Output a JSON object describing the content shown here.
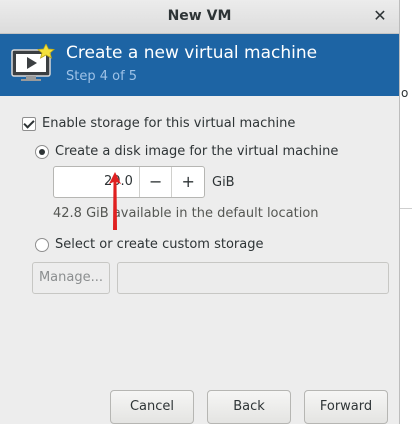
{
  "window": {
    "title": "New VM"
  },
  "header": {
    "title": "Create a new virtual machine",
    "step": "Step 4 of 5"
  },
  "storage": {
    "enable_label": "Enable storage for this virtual machine",
    "create_label": "Create a disk image for the virtual machine",
    "size_value": "20.0",
    "minus_label": "−",
    "plus_label": "+",
    "unit": "GiB",
    "available": "42.8 GiB available in the default location",
    "custom_label": "Select or create custom storage",
    "manage_label": "Manage..."
  },
  "buttons": {
    "cancel": "Cancel",
    "back": "Back",
    "forward": "Forward"
  },
  "background": {
    "glyph": "o"
  },
  "colors": {
    "header_bg": "#1d64a4",
    "annotation_arrow": "#e02020"
  }
}
